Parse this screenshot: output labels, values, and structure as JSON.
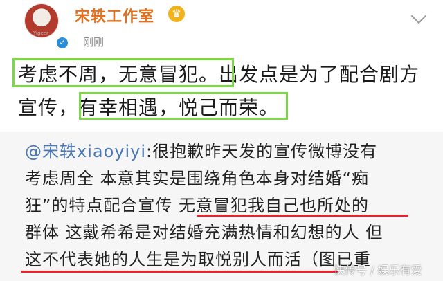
{
  "header": {
    "username": "宋轶工作室",
    "avatar_tag": "Yigeer",
    "post_time": "刚刚",
    "crown_icon": "crown-icon",
    "verified_icon": "verified-icon",
    "menu_icon": "chevron-down-icon"
  },
  "post": {
    "lines": [
      "考虑不周，无意冒犯。出发点是为了配合剧方",
      "宣传，有幸相遇，悦己而荣。"
    ],
    "highlight_color": "#7bd847"
  },
  "quote": {
    "handle": "@宋轶xiaoyiyi",
    "line1_rest": ":很抱歉昨天发的宣传微博没有",
    "line2": "考虑周全 本意其实是围绕角色本身对结婚“痴",
    "line3": "狂”的特点配合宣传 无意冒犯我自己也所处的",
    "line4": "群体 这戴希希是对结婚充满热情和幻想的人 但",
    "line5": "这不代表她的人生是为取悦别人而活（图已重",
    "underline_color": "#e8232f"
  },
  "watermark": "快传号 / 娱乐有爱"
}
